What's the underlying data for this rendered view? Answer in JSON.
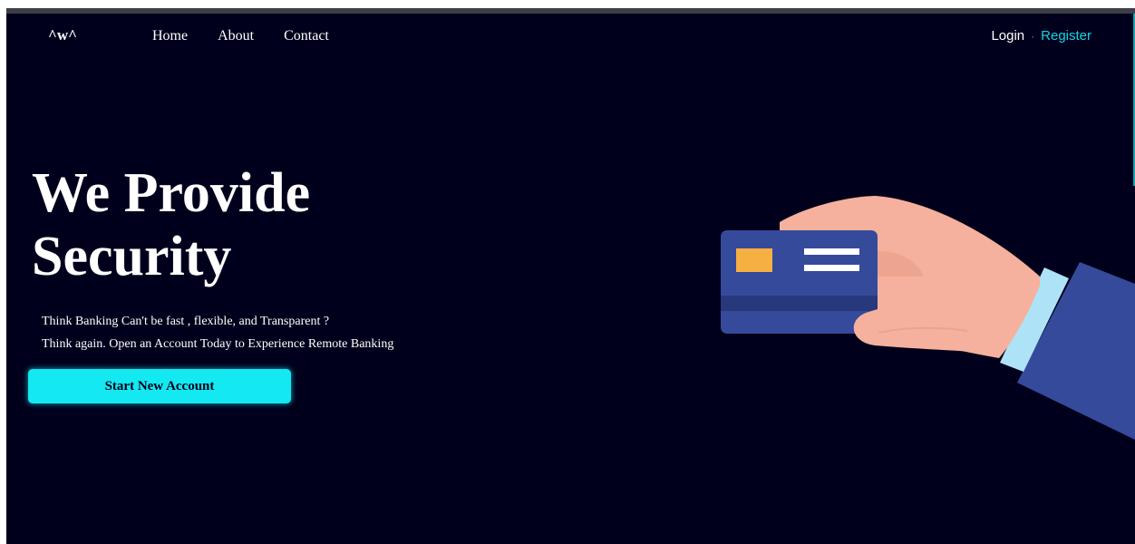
{
  "header": {
    "logo": "^w^",
    "nav": [
      {
        "label": "Home"
      },
      {
        "label": "About"
      },
      {
        "label": "Contact"
      }
    ],
    "auth": {
      "login": "Login",
      "separator": "·",
      "register": "Register"
    }
  },
  "hero": {
    "title_line1": "We Provide",
    "title_line2": "Security",
    "subtitle_line1": "Think Banking Can't be fast , flexible, and Transparent ?",
    "subtitle_line2": "Think again. Open an Account Today to Experience Remote Banking",
    "cta_label": "Start New Account"
  },
  "illustration": {
    "name": "hand-holding-credit-card",
    "card_color": "#364a9b",
    "chip_color": "#f5b041",
    "skin_color": "#f5b19d",
    "sleeve_color": "#364a9b",
    "cuff_color": "#aee3f7"
  },
  "colors": {
    "background": "#00001c",
    "accent": "#14e8f1",
    "register_link": "#14d4e6",
    "text": "#ffffff"
  }
}
